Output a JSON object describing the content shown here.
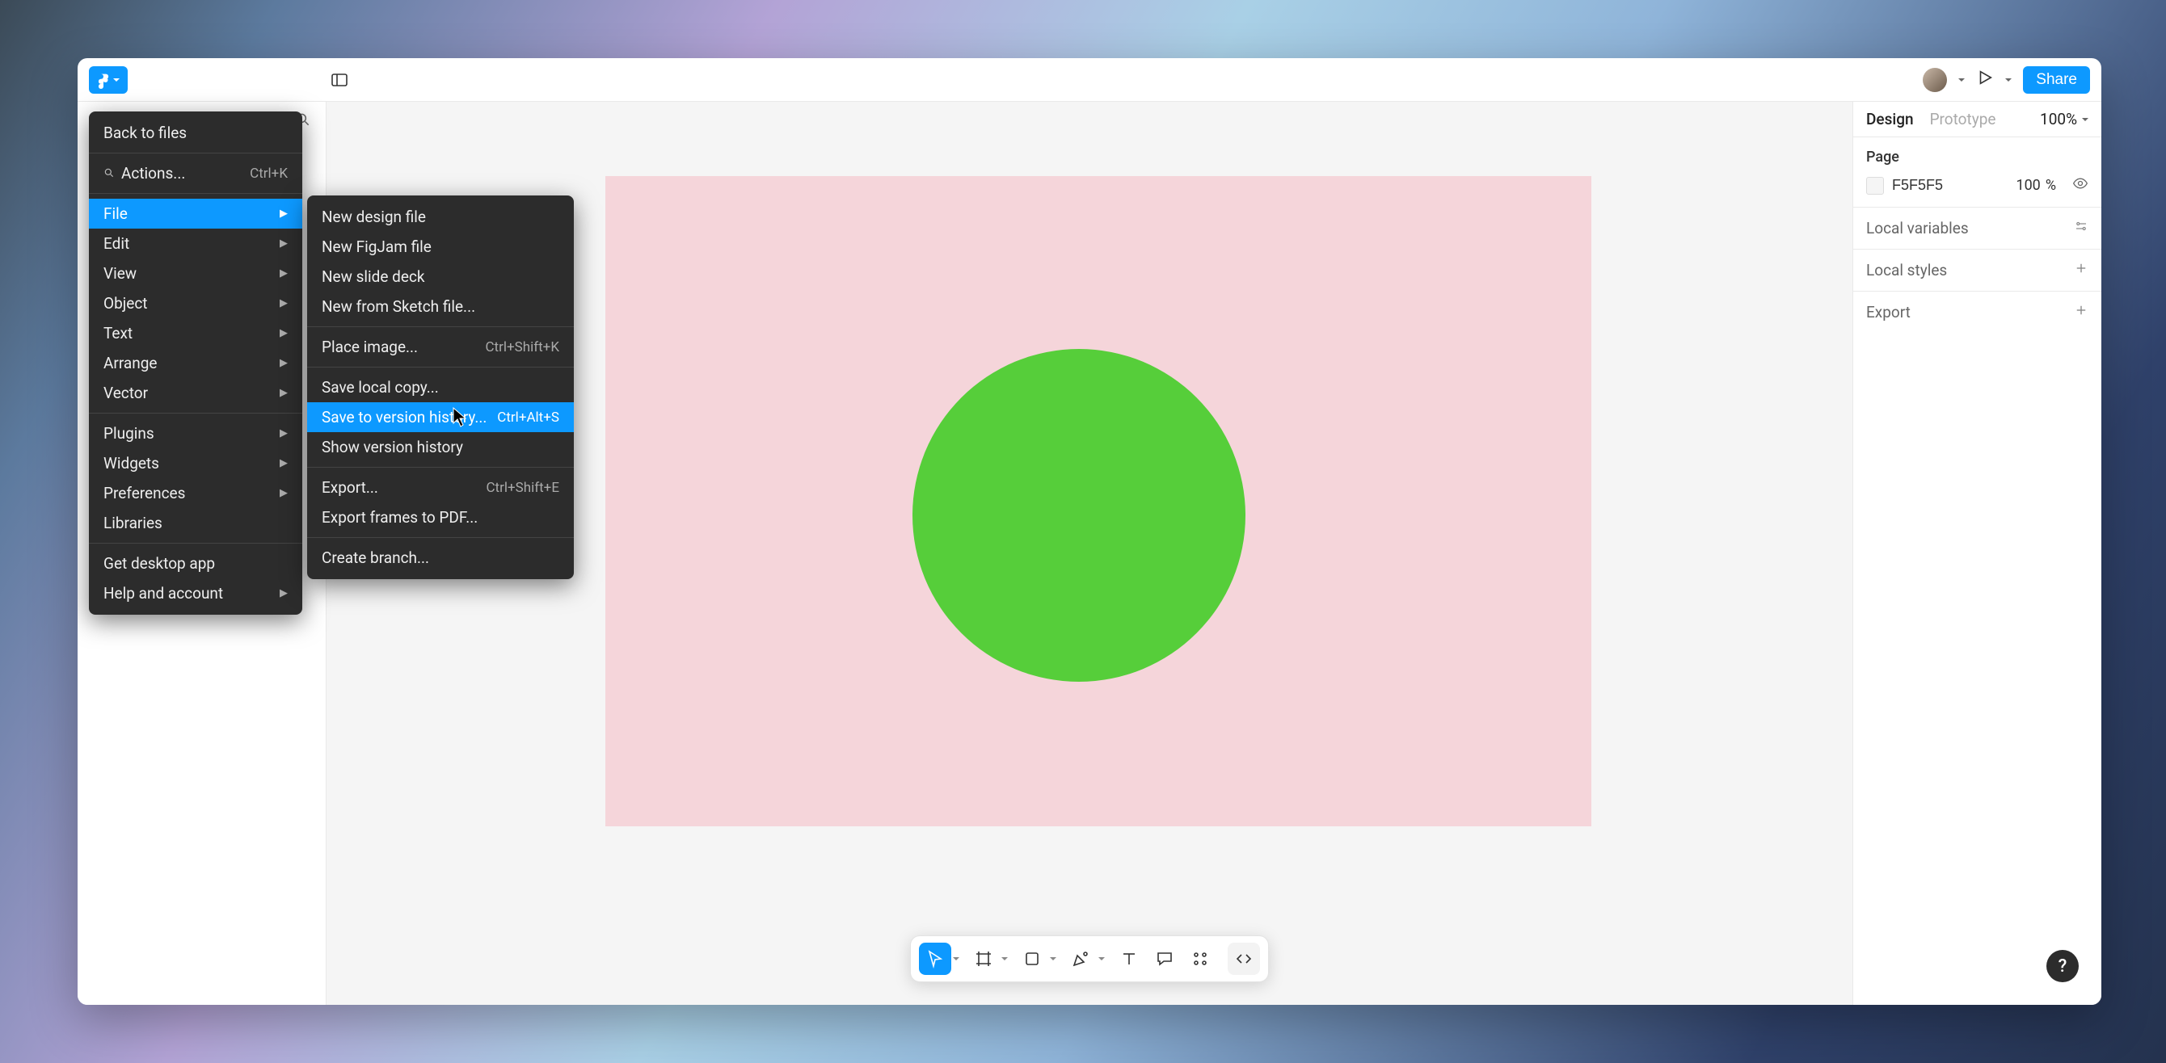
{
  "menu": {
    "back": "Back to files",
    "actions": "Actions...",
    "actions_shortcut": "Ctrl+K",
    "items": [
      "File",
      "Edit",
      "View",
      "Object",
      "Text",
      "Arrange",
      "Vector"
    ],
    "plugins": "Plugins",
    "widgets": "Widgets",
    "preferences": "Preferences",
    "libraries": "Libraries",
    "get_desktop": "Get desktop app",
    "help": "Help and account"
  },
  "submenu": {
    "new_design": "New design file",
    "new_figjam": "New FigJam file",
    "new_slide": "New slide deck",
    "new_sketch": "New from Sketch file...",
    "place_image": "Place image...",
    "place_image_sc": "Ctrl+Shift+K",
    "save_local": "Save local copy...",
    "save_version": "Save to version history...",
    "save_version_sc": "Ctrl+Alt+S",
    "show_version": "Show version history",
    "export": "Export...",
    "export_sc": "Ctrl+Shift+E",
    "export_frames": "Export frames to PDF...",
    "create_branch": "Create branch..."
  },
  "topbar": {
    "share": "Share"
  },
  "right": {
    "design": "Design",
    "prototype": "Prototype",
    "zoom": "100%",
    "page": "Page",
    "page_color": "F5F5F5",
    "opacity_val": "100",
    "opacity_pct": "%",
    "local_variables": "Local variables",
    "local_styles": "Local styles",
    "export": "Export"
  },
  "help": "?",
  "canvas": {
    "frame_bg": "#f5d5da",
    "circle_fill": "#56ce3a"
  }
}
